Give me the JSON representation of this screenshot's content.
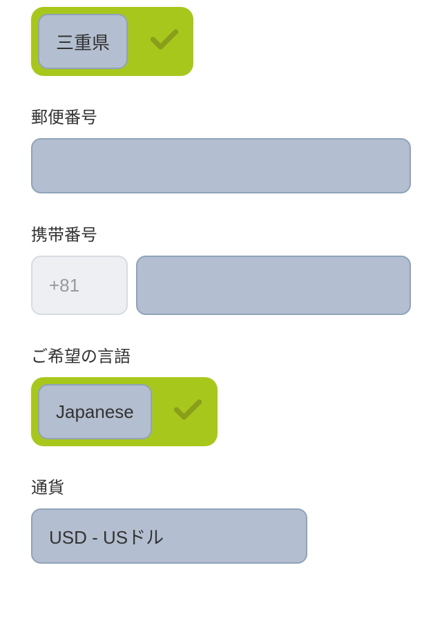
{
  "prefecture": {
    "value": "三重県"
  },
  "postal_code": {
    "label": "郵便番号",
    "value": ""
  },
  "mobile": {
    "label": "携带番号",
    "prefix": "+81",
    "value": ""
  },
  "language": {
    "label": "ご希望の言語",
    "value": "Japanese"
  },
  "currency": {
    "label": "通貨",
    "value": "USD - USドル"
  },
  "colors": {
    "accent": "#a8c71c",
    "input_bg": "#b3bed0",
    "input_border": "#8fa3b9",
    "disabled_bg": "#edeff3"
  }
}
